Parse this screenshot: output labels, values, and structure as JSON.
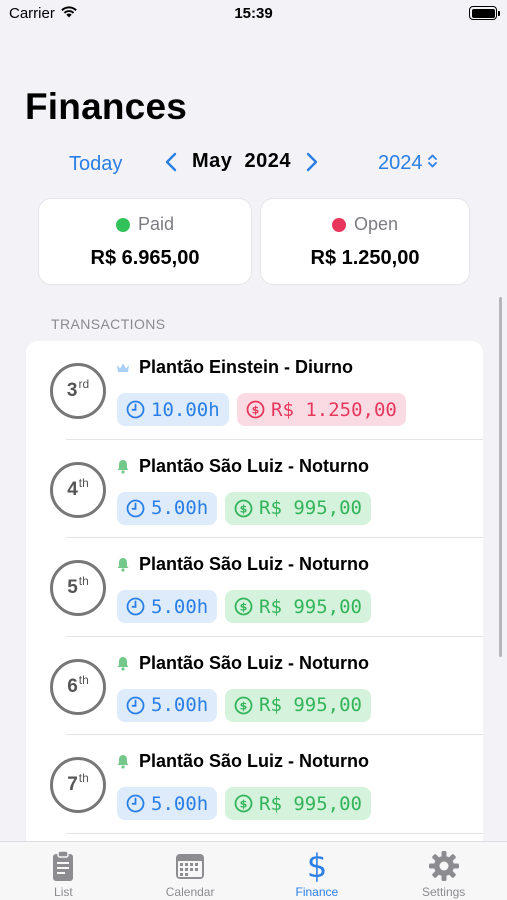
{
  "status_bar": {
    "carrier": "Carrier",
    "time": "15:39"
  },
  "title": "Finances",
  "nav": {
    "today": "Today",
    "month": "May",
    "year": "2024",
    "year_picker": "2024"
  },
  "summary": {
    "paid": {
      "label": "Paid",
      "value": "R$ 6.965,00",
      "color": "#33c15a"
    },
    "open": {
      "label": "Open",
      "value": "R$ 1.250,00",
      "color": "#e8355b"
    }
  },
  "transactions_label": "TRANSACTIONS",
  "transactions": [
    {
      "day": "3",
      "suffix": "rd",
      "icon": "crown-icon",
      "title": "Plantão Einstein - Diurno",
      "hours": "10.00h",
      "amount": "R$ 1.250,00",
      "status": "open"
    },
    {
      "day": "4",
      "suffix": "th",
      "icon": "bell-icon",
      "title": "Plantão São Luiz - Noturno",
      "hours": "5.00h",
      "amount": "R$ 995,00",
      "status": "paid"
    },
    {
      "day": "5",
      "suffix": "th",
      "icon": "bell-icon",
      "title": "Plantão São Luiz - Noturno",
      "hours": "5.00h",
      "amount": "R$ 995,00",
      "status": "paid"
    },
    {
      "day": "6",
      "suffix": "th",
      "icon": "bell-icon",
      "title": "Plantão São Luiz - Noturno",
      "hours": "5.00h",
      "amount": "R$ 995,00",
      "status": "paid"
    },
    {
      "day": "7",
      "suffix": "th",
      "icon": "bell-icon",
      "title": "Plantão São Luiz - Noturno",
      "hours": "5.00h",
      "amount": "R$ 995,00",
      "status": "paid"
    }
  ],
  "tabs": [
    {
      "label": "List",
      "icon": "clipboard-icon"
    },
    {
      "label": "Calendar",
      "icon": "calendar-icon"
    },
    {
      "label": "Finance",
      "icon": "dollar-icon",
      "active": true
    },
    {
      "label": "Settings",
      "icon": "gear-icon"
    }
  ],
  "colors": {
    "accent": "#2a7fe6",
    "paid": "#33b45a",
    "open": "#e6385e"
  }
}
